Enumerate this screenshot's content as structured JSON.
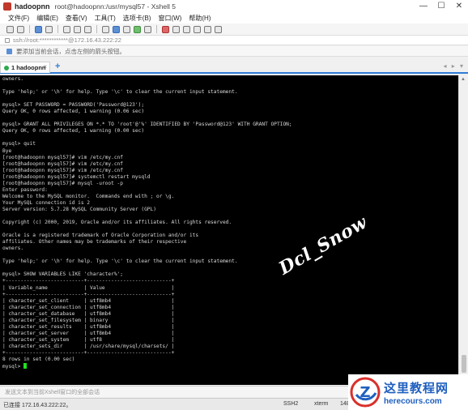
{
  "titlebar": {
    "app_name": "hadoopnn",
    "subtitle": "root@hadoopnn:/usr/mysql57 - Xshell 5",
    "minimize": "—",
    "maximize": "☐",
    "close": "✕"
  },
  "menu": {
    "file": "文件(F)",
    "edit": "编辑(E)",
    "view": "查看(V)",
    "tools": "工具(T)",
    "tabs": "选项卡(B)",
    "window": "窗口(W)",
    "help": "帮助(H)"
  },
  "address": {
    "text": "ssh://root:************@172.16.43.222:22"
  },
  "hint": {
    "text": "要添加当前会话，点击左侧的箭头按钮。"
  },
  "tabs": {
    "active_label": "1 hadoopnn",
    "close": "×",
    "add": "+",
    "nav": "◂ ▸ ▾"
  },
  "terminal": {
    "text": "owners.\n\nType 'help;' or '\\h' for help. Type '\\c' to clear the current input statement.\n\nmysql> SET PASSWORD = PASSWORD('Password@123');\nQuery OK, 0 rows affected, 1 warning (0.06 sec)\n\nmysql> GRANT ALL PRIVILEGES ON *.* TO 'root'@'%' IDENTIFIED BY 'Password@123' WITH GRANT OPTION;\nQuery OK, 0 rows affected, 1 warning (0.00 sec)\n\nmysql> quit\nBye\n[root@hadoopnn mysql57]# vim /etc/my.cnf\n[root@hadoopnn mysql57]# vim /etc/my.cnf\n[root@hadoopnn mysql57]# vim /etc/my.cnf\n[root@hadoopnn mysql57]# systemctl restart mysqld\n[root@hadoopnn mysql57]# mysql -uroot -p\nEnter password:\nWelcome to the MySQL monitor.  Commands end with ; or \\g.\nYour MySQL connection id is 2\nServer version: 5.7.28 MySQL Community Server (GPL)\n\nCopyright (c) 2000, 2019, Oracle and/or its affiliates. All rights reserved.\n\nOracle is a registered trademark of Oracle Corporation and/or its\naffiliates. Other names may be trademarks of their respective\nowners.\n\nType 'help;' or '\\h' for help. Type '\\c' to clear the current input statement.\n\nmysql> SHOW VARIABLES LIKE 'character%';\n+--------------------------+----------------------------+\n| Variable_name            | Value                      |\n+--------------------------+----------------------------+\n| character_set_client     | utf8mb4                    |\n| character_set_connection | utf8mb4                    |\n| character_set_database   | utf8mb4                    |\n| character_set_filesystem | binary                     |\n| character_set_results    | utf8mb4                    |\n| character_set_server     | utf8mb4                    |\n| character_set_system     | utf8                       |\n| character_sets_dir       | /usr/share/mysql/charsets/ |\n+--------------------------+----------------------------+\n8 rows in set (0.00 sec)\n",
    "prompt": "mysql> "
  },
  "watermark": {
    "text": "Dcl_Snow"
  },
  "sendbar": {
    "text": "发送文本到当前Xshell窗口的全部会话"
  },
  "status": {
    "connection": "已连接 172.16.43.222:22。",
    "protocol": "SSH2",
    "terminal": "xterm",
    "size": "148"
  },
  "logo": {
    "cn": "这里教程网",
    "en": "herecours.com",
    "letter": "Z"
  },
  "colors": {
    "terminal_bg": "#000000",
    "terminal_fg": "#d8d8d8",
    "cursor": "#20e020",
    "accent": "#2f7bd6",
    "logo_blue": "#1f5fbf",
    "logo_red": "#d9302b"
  }
}
